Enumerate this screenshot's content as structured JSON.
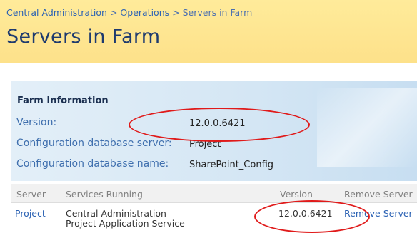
{
  "breadcrumb": {
    "items": [
      "Central Administration",
      "Operations",
      "Servers in Farm"
    ],
    "separator": ">"
  },
  "page_title": "Servers in Farm",
  "farm_info": {
    "heading": "Farm Information",
    "version_label": "Version:",
    "version_value": "12.0.0.6421",
    "config_db_server_label": "Configuration database server:",
    "config_db_server_value": "Project",
    "config_db_name_label": "Configuration database name:",
    "config_db_name_value": "SharePoint_Config"
  },
  "servers_table": {
    "columns": {
      "server": "Server",
      "services": "Services Running",
      "version": "Version",
      "remove": "Remove Server"
    },
    "rows": [
      {
        "server": "Project",
        "services": [
          "Central Administration",
          "Project Application Service"
        ],
        "version": "12.0.0.6421",
        "remove": "Remove Server"
      }
    ]
  },
  "colors": {
    "header_bg": "#fde18a",
    "title": "#1e3a6e",
    "link": "#2d63b4",
    "annotation": "#e01a1a"
  }
}
